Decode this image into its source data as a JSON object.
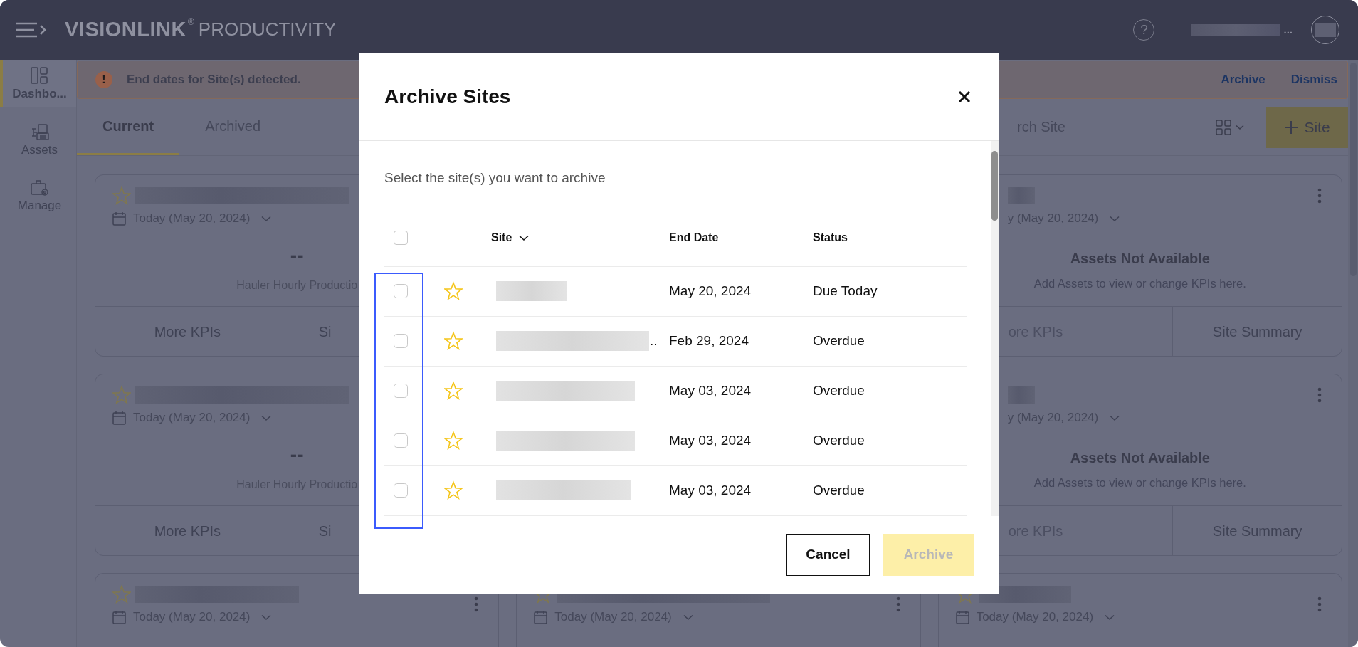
{
  "topbar": {
    "brand": "VISIONLINK",
    "registered": "®",
    "product": "PRODUCTIVITY",
    "help_glyph": "?",
    "user_ellipsis": "..."
  },
  "sidebar": {
    "items": [
      {
        "label": "Dashbo...",
        "selected": true
      },
      {
        "label": "Assets",
        "selected": false
      },
      {
        "label": "Manage",
        "selected": false
      }
    ]
  },
  "alert": {
    "glyph": "!",
    "message": "End dates for Site(s) detected.",
    "actions": [
      "Archive",
      "Dismiss"
    ]
  },
  "tabs": [
    {
      "label": "Current",
      "selected": true
    },
    {
      "label": "Archived",
      "selected": false
    }
  ],
  "toolbar": {
    "search_placeholder": "rch Site",
    "add_button": "Site"
  },
  "columns": [
    {
      "cards": [
        {
          "kind": "kpi",
          "menu": false,
          "date": "Today (May 20, 2024)",
          "value": "--",
          "metric": "Hauler Hourly Productio",
          "buttons": [
            {
              "label": "More KPIs",
              "disabled": false
            },
            {
              "label": "Si",
              "disabled": false
            }
          ]
        },
        {
          "kind": "kpi",
          "menu": false,
          "date": "Today (May 20, 2024)",
          "value": "--",
          "metric": "Hauler Hourly Productio",
          "buttons": [
            {
              "label": "More KPIs",
              "disabled": false
            },
            {
              "label": "Si",
              "disabled": false
            }
          ]
        },
        {
          "kind": "header",
          "menu": true,
          "date": "Today (May 20, 2024)"
        }
      ]
    },
    {
      "cards": [
        {
          "kind": "header",
          "menu": true,
          "date": "Today (May 20, 2024)"
        }
      ]
    },
    {
      "cards": [
        {
          "kind": "empty",
          "menu": true,
          "date": "y (May 20, 2024)",
          "title": "Assets Not Available",
          "message": "Add Assets to view or change KPIs here.",
          "buttons": [
            {
              "label": "ore KPIs",
              "disabled": true
            },
            {
              "label": "Site Summary",
              "disabled": false
            }
          ]
        },
        {
          "kind": "empty",
          "menu": true,
          "date": "y (May 20, 2024)",
          "title": "Assets Not Available",
          "message": "Add Assets to view or change KPIs here.",
          "buttons": [
            {
              "label": "ore KPIs",
              "disabled": true
            },
            {
              "label": "Site Summary",
              "disabled": false
            }
          ]
        },
        {
          "kind": "header",
          "menu": true,
          "date": "Today (May 20, 2024)"
        }
      ]
    }
  ],
  "modal": {
    "title": "Archive Sites",
    "description": "Select the site(s) you want to archive",
    "columns": [
      "Site",
      "End Date",
      "Status"
    ],
    "select_all_checked": false,
    "rows": [
      {
        "checked": false,
        "end_date": "May 20, 2024",
        "status": "Due Today"
      },
      {
        "checked": false,
        "site_ellipsis": "..",
        "end_date": "Feb 29, 2024",
        "status": "Overdue"
      },
      {
        "checked": false,
        "end_date": "May 03, 2024",
        "status": "Overdue"
      },
      {
        "checked": false,
        "end_date": "May 03, 2024",
        "status": "Overdue"
      },
      {
        "checked": false,
        "end_date": "May 03, 2024",
        "status": "Overdue"
      }
    ],
    "buttons": [
      {
        "label": "Cancel",
        "kind": "secondary",
        "disabled": false
      },
      {
        "label": "Archive",
        "kind": "primary",
        "disabled": true
      }
    ]
  }
}
